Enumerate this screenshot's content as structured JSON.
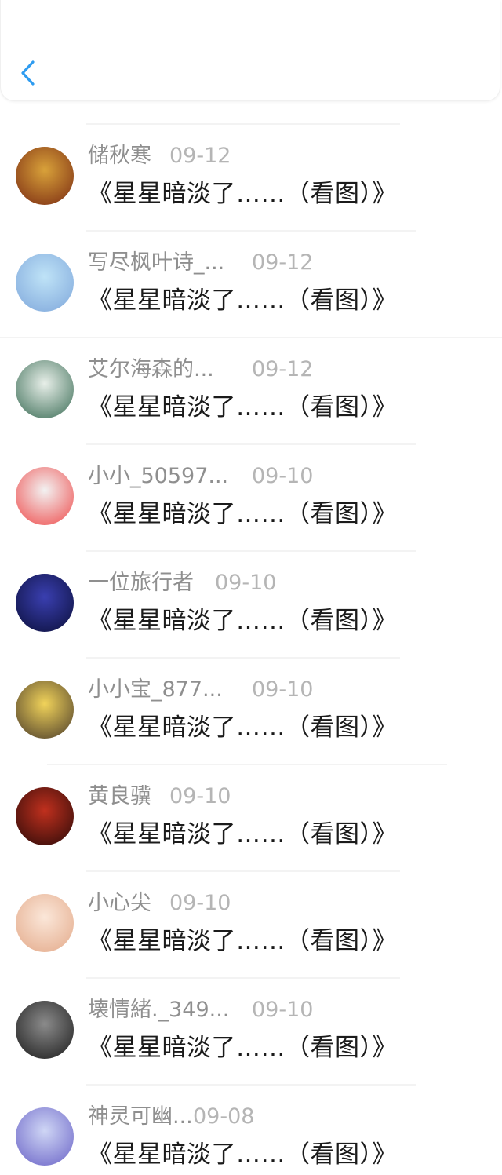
{
  "header": {
    "back_icon": "chevron-left-icon",
    "accent": "#2f9cf0"
  },
  "items": [
    {
      "username": "储秋寒",
      "date": "09-12",
      "title": "《星星暗淡了……（看图）》",
      "avatar_colors": [
        "#d9a23a",
        "#7a2a12"
      ]
    },
    {
      "username": "写尽枫叶诗_...",
      "date": "09-12",
      "title": "《星星暗淡了……（看图）》",
      "avatar_colors": [
        "#bfe3f7",
        "#7fa7db"
      ]
    },
    {
      "username": "艾尔海森的...",
      "date": "09-12",
      "title": "《星星暗淡了……（看图）》",
      "avatar_colors": [
        "#e8efe9",
        "#3a6c55"
      ]
    },
    {
      "username": "小小_50597...",
      "date": "09-10",
      "title": "《星星暗淡了……（看图）》",
      "avatar_colors": [
        "#f2f2f2",
        "#ef4b4b"
      ]
    },
    {
      "username": "一位旅行者",
      "date": "09-10",
      "title": "《星星暗淡了……（看图）》",
      "avatar_colors": [
        "#3a3fb0",
        "#0b0f3a"
      ]
    },
    {
      "username": "小小宝_877...",
      "date": "09-10",
      "title": "《星星暗淡了……（看图）》",
      "avatar_colors": [
        "#f1d35a",
        "#4a3b2a"
      ]
    },
    {
      "username": "黄良骥",
      "date": "09-10",
      "title": "《星星暗淡了……（看图）》",
      "avatar_colors": [
        "#c0301e",
        "#2a0a08"
      ]
    },
    {
      "username": "小心尖",
      "date": "09-10",
      "title": "《星星暗淡了……（看图）》",
      "avatar_colors": [
        "#fbe7d9",
        "#e3a989"
      ]
    },
    {
      "username": "壊情緒._349...",
      "date": "09-10",
      "title": "《星星暗淡了……（看图）》",
      "avatar_colors": [
        "#8b8b8b",
        "#1b1b1b"
      ]
    },
    {
      "username": "神灵可幽...",
      "date": "09-08",
      "title": "《星星暗淡了……（看图）》",
      "avatar_colors": [
        "#cfd6f5",
        "#6a63c7"
      ]
    }
  ]
}
